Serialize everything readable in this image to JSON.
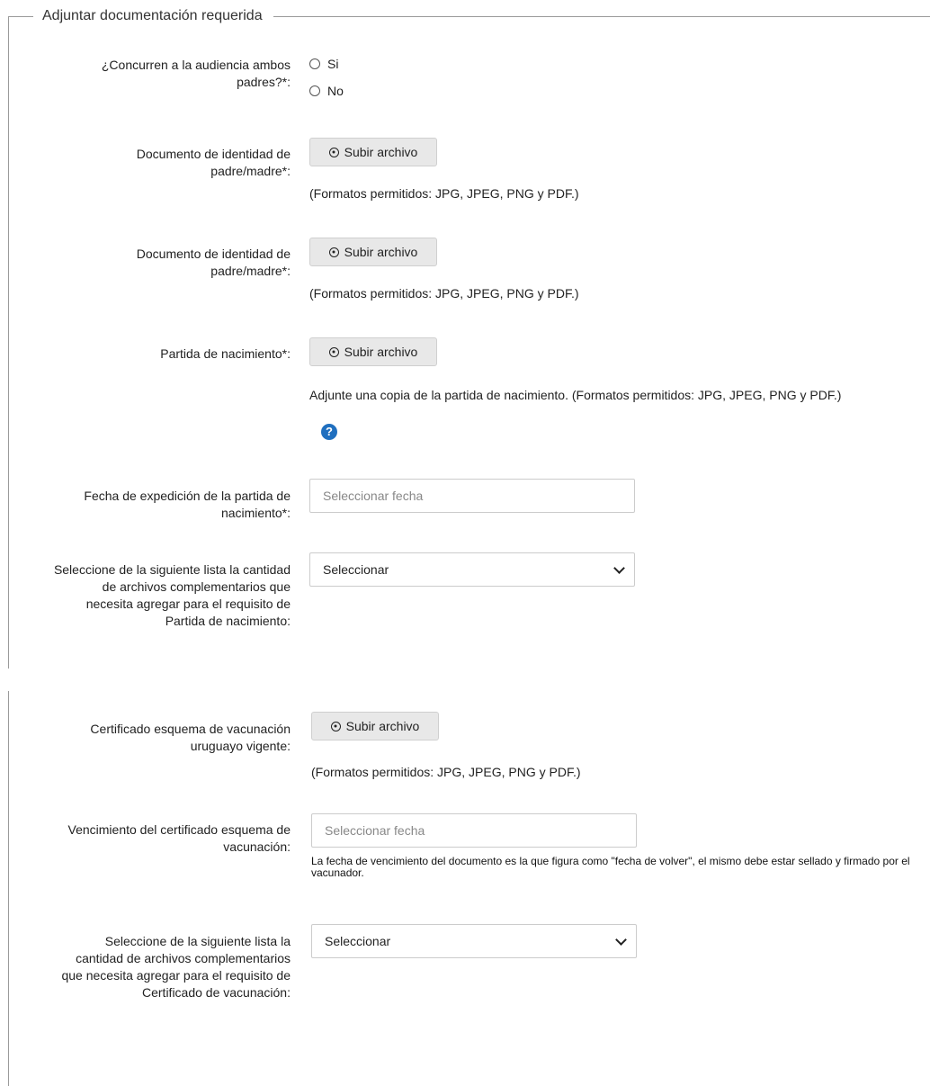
{
  "section": {
    "title": "Adjuntar documentación requerida"
  },
  "fields": {
    "parents": {
      "label": "¿Concurren a la audiencia ambos padres?*:",
      "options": [
        "Si",
        "No"
      ]
    },
    "id_doc_1": {
      "label": "Documento de identidad de padre/madre*:",
      "button": "Subir archivo",
      "hint": "(Formatos permitidos: JPG, JPEG, PNG y PDF.)"
    },
    "id_doc_2": {
      "label": "Documento de identidad de padre/madre*:",
      "button": "Subir archivo",
      "hint": "(Formatos permitidos: JPG, JPEG, PNG y PDF.)"
    },
    "birth_cert": {
      "label": "Partida de nacimiento*:",
      "button": "Subir archivo",
      "hint": "Adjunte una copia de la partida de nacimiento. (Formatos permitidos: JPG, JPEG, PNG y PDF.)"
    },
    "birth_cert_date": {
      "label": "Fecha de expedición de la partida de nacimiento*:",
      "placeholder": "Seleccionar fecha"
    },
    "birth_cert_extra": {
      "label": "Seleccione de la siguiente lista la cantidad de archivos complementarios que necesita agregar para el requisito de Partida de nacimiento:",
      "selected": "Seleccionar"
    },
    "vaccine_cert": {
      "label": "Certificado esquema de vacunación uruguayo vigente:",
      "button": "Subir archivo",
      "hint": "(Formatos permitidos: JPG, JPEG, PNG y PDF.)"
    },
    "vaccine_expiry": {
      "label": "Vencimiento del certificado esquema de vacunación:",
      "placeholder": "Seleccionar fecha",
      "hint": "La fecha de vencimiento del documento es la que figura como \"fecha de volver\", el mismo debe estar sellado y firmado por el vacunador."
    },
    "vaccine_extra": {
      "label": "Seleccione de la siguiente lista la cantidad de archivos complementarios que necesita agregar para el requisito de Certificado de vacunación:",
      "selected": "Seleccionar"
    }
  },
  "icons": {
    "upload": "upload-circle-icon",
    "help": "question-mark-icon",
    "help_glyph": "?"
  },
  "colors": {
    "help": "#1f6fbf",
    "button_bg": "#e8e8e8",
    "border": "#9a9a9a"
  }
}
